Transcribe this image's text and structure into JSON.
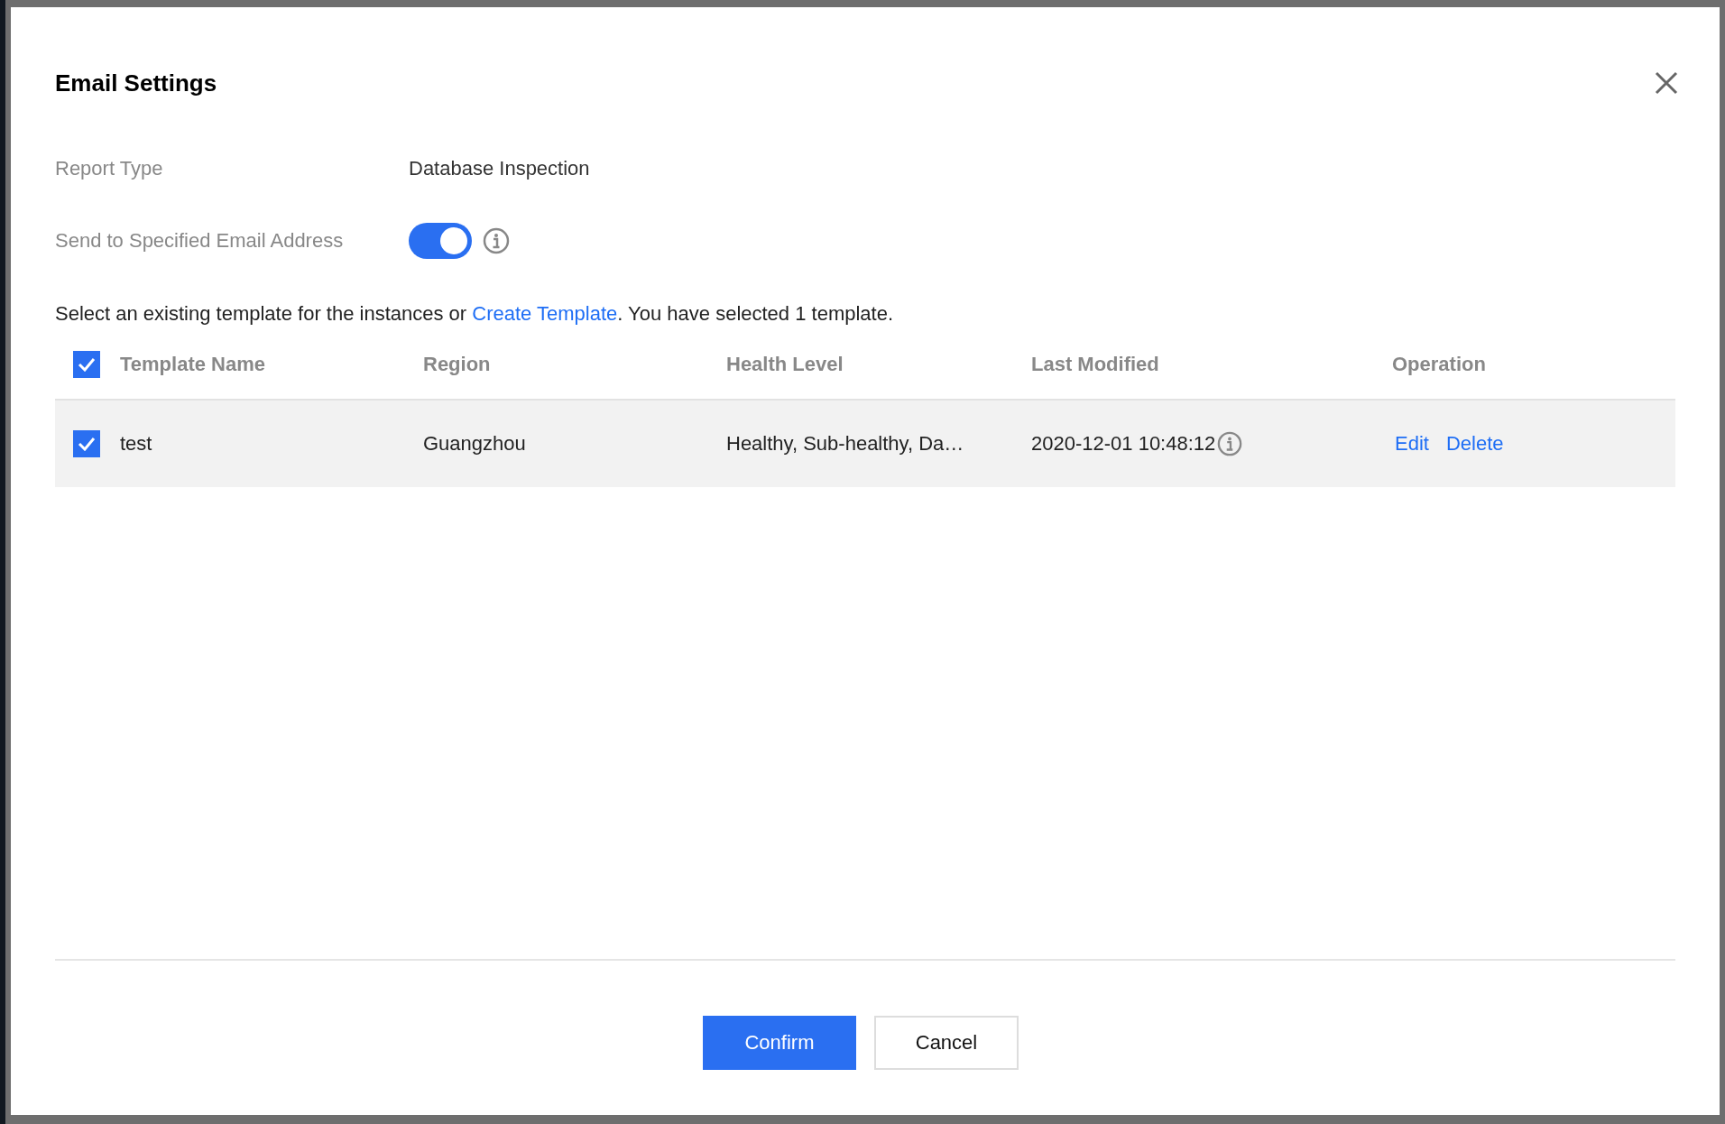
{
  "dialog": {
    "title": "Email Settings"
  },
  "fields": [
    {
      "kind": "text",
      "label": "Report Type",
      "value": "Database Inspection"
    },
    {
      "kind": "switch",
      "label": "Send to Specified Email Address",
      "on": true
    }
  ],
  "intro": {
    "before": "Select an existing template for the instances or ",
    "link": "Create Template",
    "after": ". You have selected 1 template."
  },
  "table": {
    "all_checked": true,
    "columns": [
      "Template Name",
      "Region",
      "Health Level",
      "Last Modified",
      "Operation"
    ],
    "rows": [
      {
        "checked": true,
        "cells": [
          "test",
          "Guangzhou",
          "Healthy, Sub-healthy, Da…",
          "2020-12-01 10:48:12"
        ],
        "actions": [
          "Edit",
          "Delete"
        ]
      }
    ]
  },
  "buttons": [
    {
      "label": "Confirm",
      "kind": "primary"
    },
    {
      "label": "Cancel",
      "kind": "default"
    }
  ]
}
